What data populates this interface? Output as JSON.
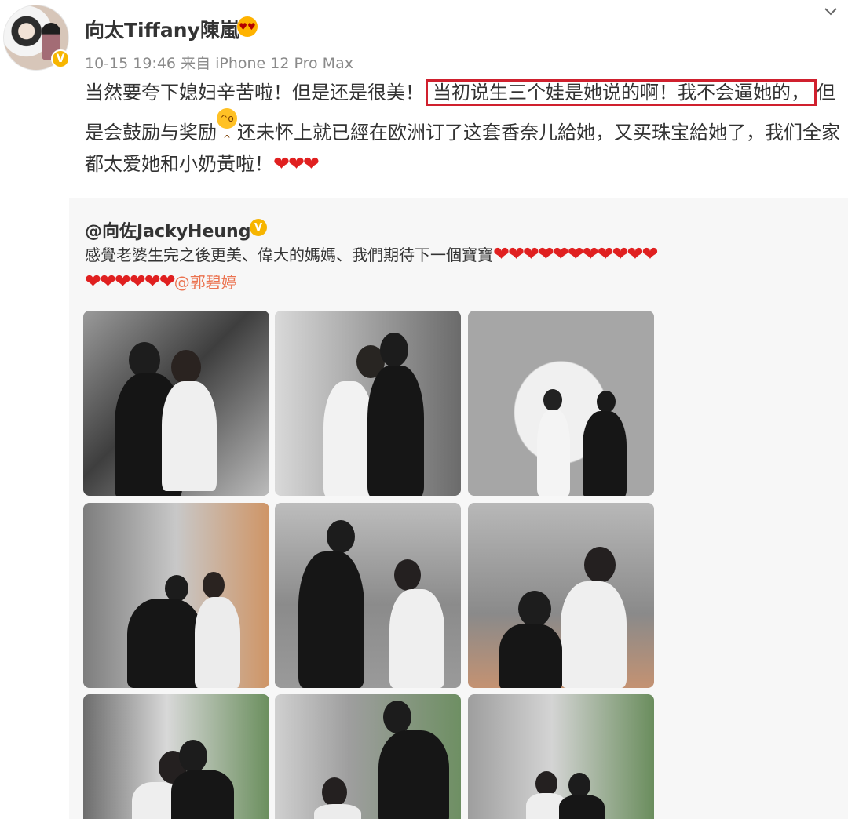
{
  "header": {
    "name": "向太Tiffany陳嵐",
    "time": "10-15 19:46",
    "source": "来自 iPhone 12 Pro Max"
  },
  "content": {
    "part1": "当然要夸下媳妇辛苦啦！但是还是很美！",
    "highlighted": "当初说生三个娃是她说的啊！我不会逼她的，",
    "part2": "但是会鼓励与奖励",
    "part3": "还未怀上就已經在欧洲订了这套香奈儿給她，又买珠宝給她了，我们全家都太爱她和小奶黃啦！",
    "hearts": "❤❤❤"
  },
  "repost": {
    "author": "@向佐JackyHeung",
    "text": "感覺老婆生完之後更美、偉大的媽媽、我們期待下一個寶寶",
    "hearts_line1": "❤❤❤❤❤❤❤❤❤❤❤",
    "hearts_line2": "❤❤❤❤❤❤",
    "mention": "@郭碧婷"
  },
  "icons": {
    "verified": "verified-badge-icon",
    "dropdown": "chevron-down-icon"
  },
  "colors": {
    "highlight_box": "#d0202e",
    "mention": "#eb7350",
    "verified": "#f7b500",
    "heart": "#e02020"
  }
}
